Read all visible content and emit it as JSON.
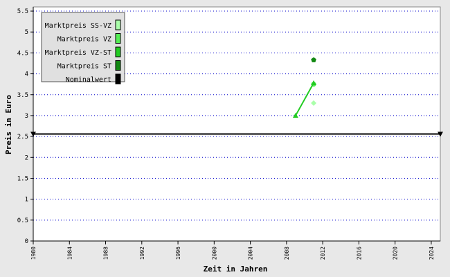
{
  "chart_data": {
    "type": "line",
    "xlabel": "Zeit in Jahren",
    "ylabel": "Preis in Euro",
    "xlim": [
      1980,
      2025
    ],
    "ylim": [
      0,
      5.6
    ],
    "x_ticks": [
      "1980",
      "1984",
      "1988",
      "1992",
      "1996",
      "2000",
      "2004",
      "2008",
      "2012",
      "2016",
      "2020",
      "2024"
    ],
    "y_ticks": [
      "0",
      "0.5",
      "1",
      "1.5",
      "2",
      "2.5",
      "3",
      "3.5",
      "4",
      "4.5",
      "5",
      "5.5"
    ],
    "grid": true,
    "legend_position": "top-left",
    "series": [
      {
        "name": "Marktpreis SS-VZ",
        "color": "#aaffaa",
        "marker": "diamond",
        "points": [
          [
            2011,
            3.3
          ]
        ]
      },
      {
        "name": "Marktpreis VZ",
        "color": "#55ee55",
        "marker": "circle",
        "points": [
          [
            2011,
            3.75
          ]
        ]
      },
      {
        "name": "Marktpreis VZ-ST",
        "color": "#22cc22",
        "marker": "triangle",
        "points": [
          [
            2009,
            3.0
          ],
          [
            2011,
            3.78
          ]
        ]
      },
      {
        "name": "Marktpreis ST",
        "color": "#118811",
        "marker": "pentagon",
        "points": [
          [
            2011,
            4.33
          ]
        ]
      },
      {
        "name": "Nominalwert",
        "color": "#000000",
        "marker": "triangle-down",
        "points": [
          [
            1980,
            2.56
          ],
          [
            2025,
            2.56
          ]
        ]
      }
    ]
  }
}
